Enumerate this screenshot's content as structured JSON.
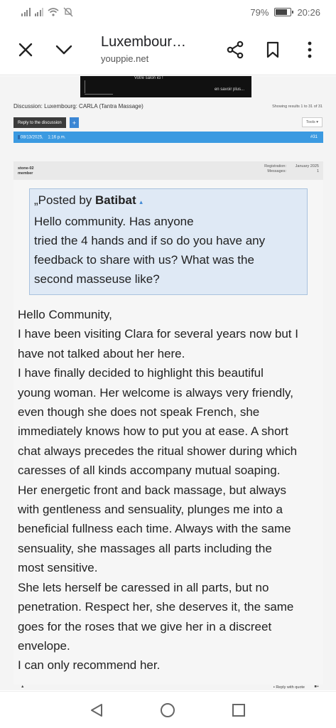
{
  "status_bar": {
    "battery": "79%",
    "time": "20:26"
  },
  "browser": {
    "page_title": "Luxembour…",
    "url": "youppie.net"
  },
  "banner": {
    "text1": "Votre salon ici !",
    "text2": "en savoir plus..."
  },
  "forum": {
    "discussion_title": "Discussion: Luxembourg: CARLA (Tantra Massage)",
    "showing": "Showing results 1 to 31 of 31",
    "reply_button": "Reply to the discussion",
    "reply_plus": "+",
    "tools": "Tools ▾"
  },
  "post": {
    "date": "08/13/2025,",
    "time": "1:16 p.m.",
    "number": "#31",
    "username": "stone-02",
    "role": "member",
    "registration_label": "Registration:",
    "registration_value": "January 2025",
    "messages_label": "Messages:",
    "messages_value": "1",
    "quote": {
      "prefix": "Posted by",
      "author": "Batibat",
      "lines": [
        "Hello community. Has anyone",
        "tried the 4 hands and if so do you have any",
        "feedback to share with us? What was the",
        "second masseuse like?"
      ]
    },
    "message_lines": [
      "Hello Community,",
      "I have been visiting Clara for several years now but I",
      "have not talked about her here.",
      "I have finally decided to highlight this beautiful",
      "young woman. Her welcome is always very friendly,",
      "even though she does not speak French, she",
      "immediately knows how to put you at ease. A short",
      "chat always precedes the ritual shower during which",
      "caresses of all kinds accompany mutual soaping.",
      "Her energetic front and back massage, but always",
      "with gentleness and sensuality, plunges me into a",
      "beneficial fullness each time. Always with the same",
      "sensuality, she massages all parts including the",
      "most sensitive.",
      "She lets herself be caressed in all parts, but no",
      "penetration. Respect her, she deserves it, the same",
      "goes for the roses that we give her in a discreet",
      "envelope.",
      "I can only recommend her."
    ],
    "reply_with_quote": "Reply with quote"
  },
  "icons": {
    "close": "close-icon",
    "collapse": "chevron-down-icon",
    "share": "share-icon",
    "bookmark": "bookmark-icon",
    "menu": "more-vert-icon"
  }
}
